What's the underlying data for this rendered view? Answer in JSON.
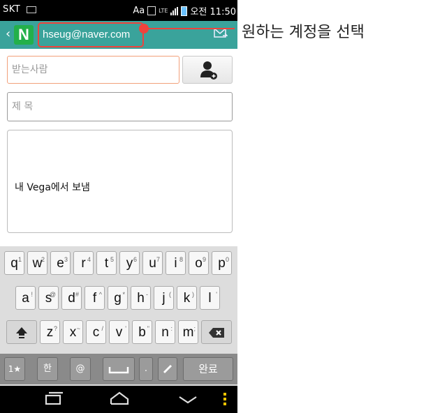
{
  "status": {
    "carrier": "SKT",
    "aa": "Aa",
    "lte": "LTE",
    "time": "오전 11:50"
  },
  "header": {
    "logo": "N",
    "account": "hseug@naver.com",
    "back_chevron": "‹"
  },
  "callout": {
    "text": "원하는 계정을 선택"
  },
  "compose": {
    "to_placeholder": "받는사람",
    "subject_placeholder": "제 목",
    "signature": "내 Vega에서 보냄"
  },
  "keyboard": {
    "row1": [
      {
        "k": "q",
        "s": "1"
      },
      {
        "k": "w",
        "s": "2"
      },
      {
        "k": "e",
        "s": "3"
      },
      {
        "k": "r",
        "s": "4"
      },
      {
        "k": "t",
        "s": "5"
      },
      {
        "k": "y",
        "s": "6"
      },
      {
        "k": "u",
        "s": "7"
      },
      {
        "k": "i",
        "s": "8"
      },
      {
        "k": "o",
        "s": "9"
      },
      {
        "k": "p",
        "s": "0"
      }
    ],
    "row2": [
      {
        "k": "a",
        "s": "!"
      },
      {
        "k": "s",
        "s": "@"
      },
      {
        "k": "d",
        "s": "#"
      },
      {
        "k": "f",
        "s": "^"
      },
      {
        "k": "g",
        "s": "*"
      },
      {
        "k": "h",
        "s": "-"
      },
      {
        "k": "j",
        "s": "("
      },
      {
        "k": "k",
        "s": ")"
      },
      {
        "k": "l",
        "s": "'"
      }
    ],
    "row3": [
      {
        "k": "z",
        "s": "?"
      },
      {
        "k": "x",
        "s": "~"
      },
      {
        "k": "c",
        "s": "/"
      },
      {
        "k": "v",
        "s": "'"
      },
      {
        "k": "b",
        "s": "\""
      },
      {
        "k": "n",
        "s": ":"
      },
      {
        "k": "m",
        "s": ";"
      }
    ],
    "symbols_key": "1★",
    "hangul_key": "한",
    "at_key": "@",
    "period_key": ".",
    "done_key": "완료"
  },
  "colors": {
    "header_teal": "#3aa39b",
    "logo_green": "#23b04a",
    "callout_red": "#f0433c",
    "status_black": "#000000"
  },
  "icons": {
    "contact": "add-contact-icon",
    "send": "send-mail-icon",
    "shift": "shift-icon",
    "backspace": "backspace-icon",
    "space": "space-icon",
    "pen": "pen-icon",
    "nav_recent": "recent-apps-icon",
    "nav_home": "home-icon",
    "nav_hide": "hide-keyboard-icon",
    "nav_menu": "menu-icon"
  }
}
